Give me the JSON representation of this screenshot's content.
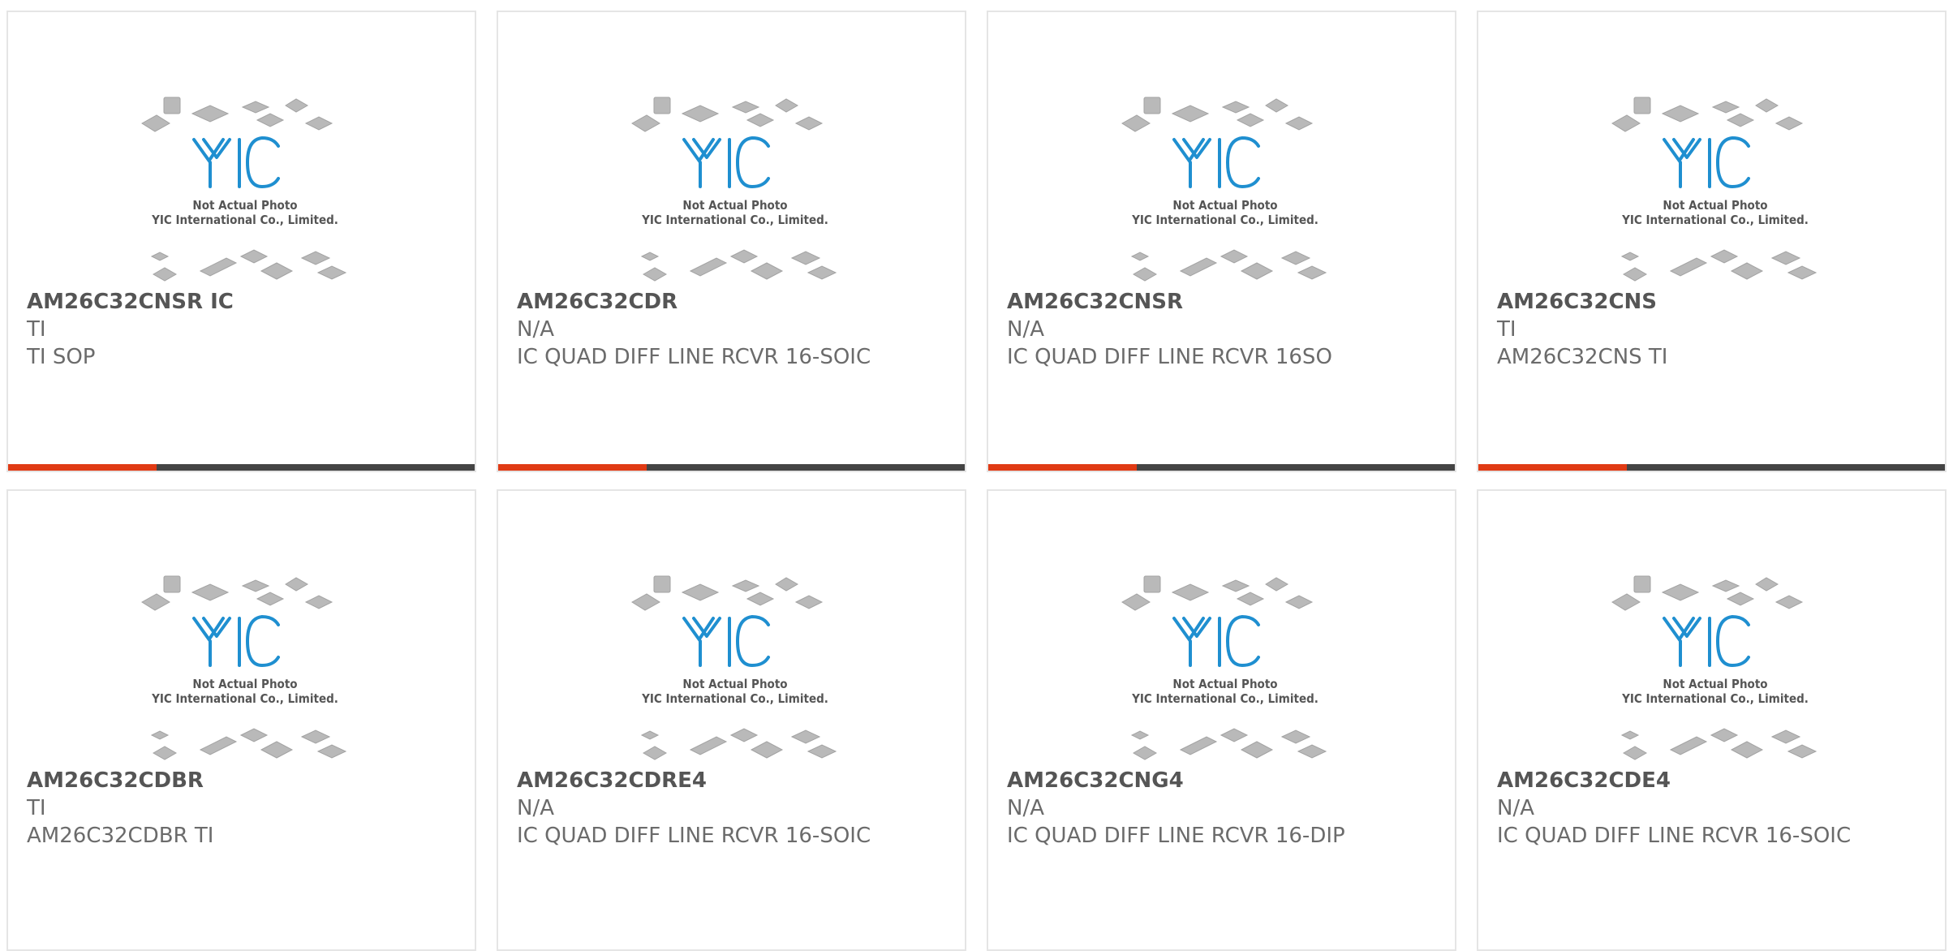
{
  "colors": {
    "accent": "#e03a14",
    "bar": "#444444",
    "logo_blue": "#1f8fd0",
    "text": "#6b6b6b"
  },
  "placeholder": {
    "logo_text": "YIC",
    "caption_line1": "Not Actual Photo",
    "caption_line2": "YIC International Co., Limited."
  },
  "products": [
    {
      "part_number": "AM26C32CNSR IC",
      "manufacturer": "TI",
      "description": "TI SOP"
    },
    {
      "part_number": "AM26C32CDR",
      "manufacturer": "N/A",
      "description": "IC QUAD DIFF LINE RCVR 16-SOIC"
    },
    {
      "part_number": "AM26C32CNSR",
      "manufacturer": "N/A",
      "description": "IC QUAD DIFF LINE RCVR 16SO"
    },
    {
      "part_number": "AM26C32CNS",
      "manufacturer": "TI",
      "description": "AM26C32CNS TI"
    },
    {
      "part_number": "AM26C32CDBR",
      "manufacturer": "TI",
      "description": "AM26C32CDBR TI"
    },
    {
      "part_number": "AM26C32CDRE4",
      "manufacturer": "N/A",
      "description": "IC QUAD DIFF LINE RCVR 16-SOIC"
    },
    {
      "part_number": "AM26C32CNG4",
      "manufacturer": "N/A",
      "description": "IC QUAD DIFF LINE RCVR 16-DIP"
    },
    {
      "part_number": "AM26C32CDE4",
      "manufacturer": "N/A",
      "description": "IC QUAD DIFF LINE RCVR 16-SOIC"
    }
  ]
}
